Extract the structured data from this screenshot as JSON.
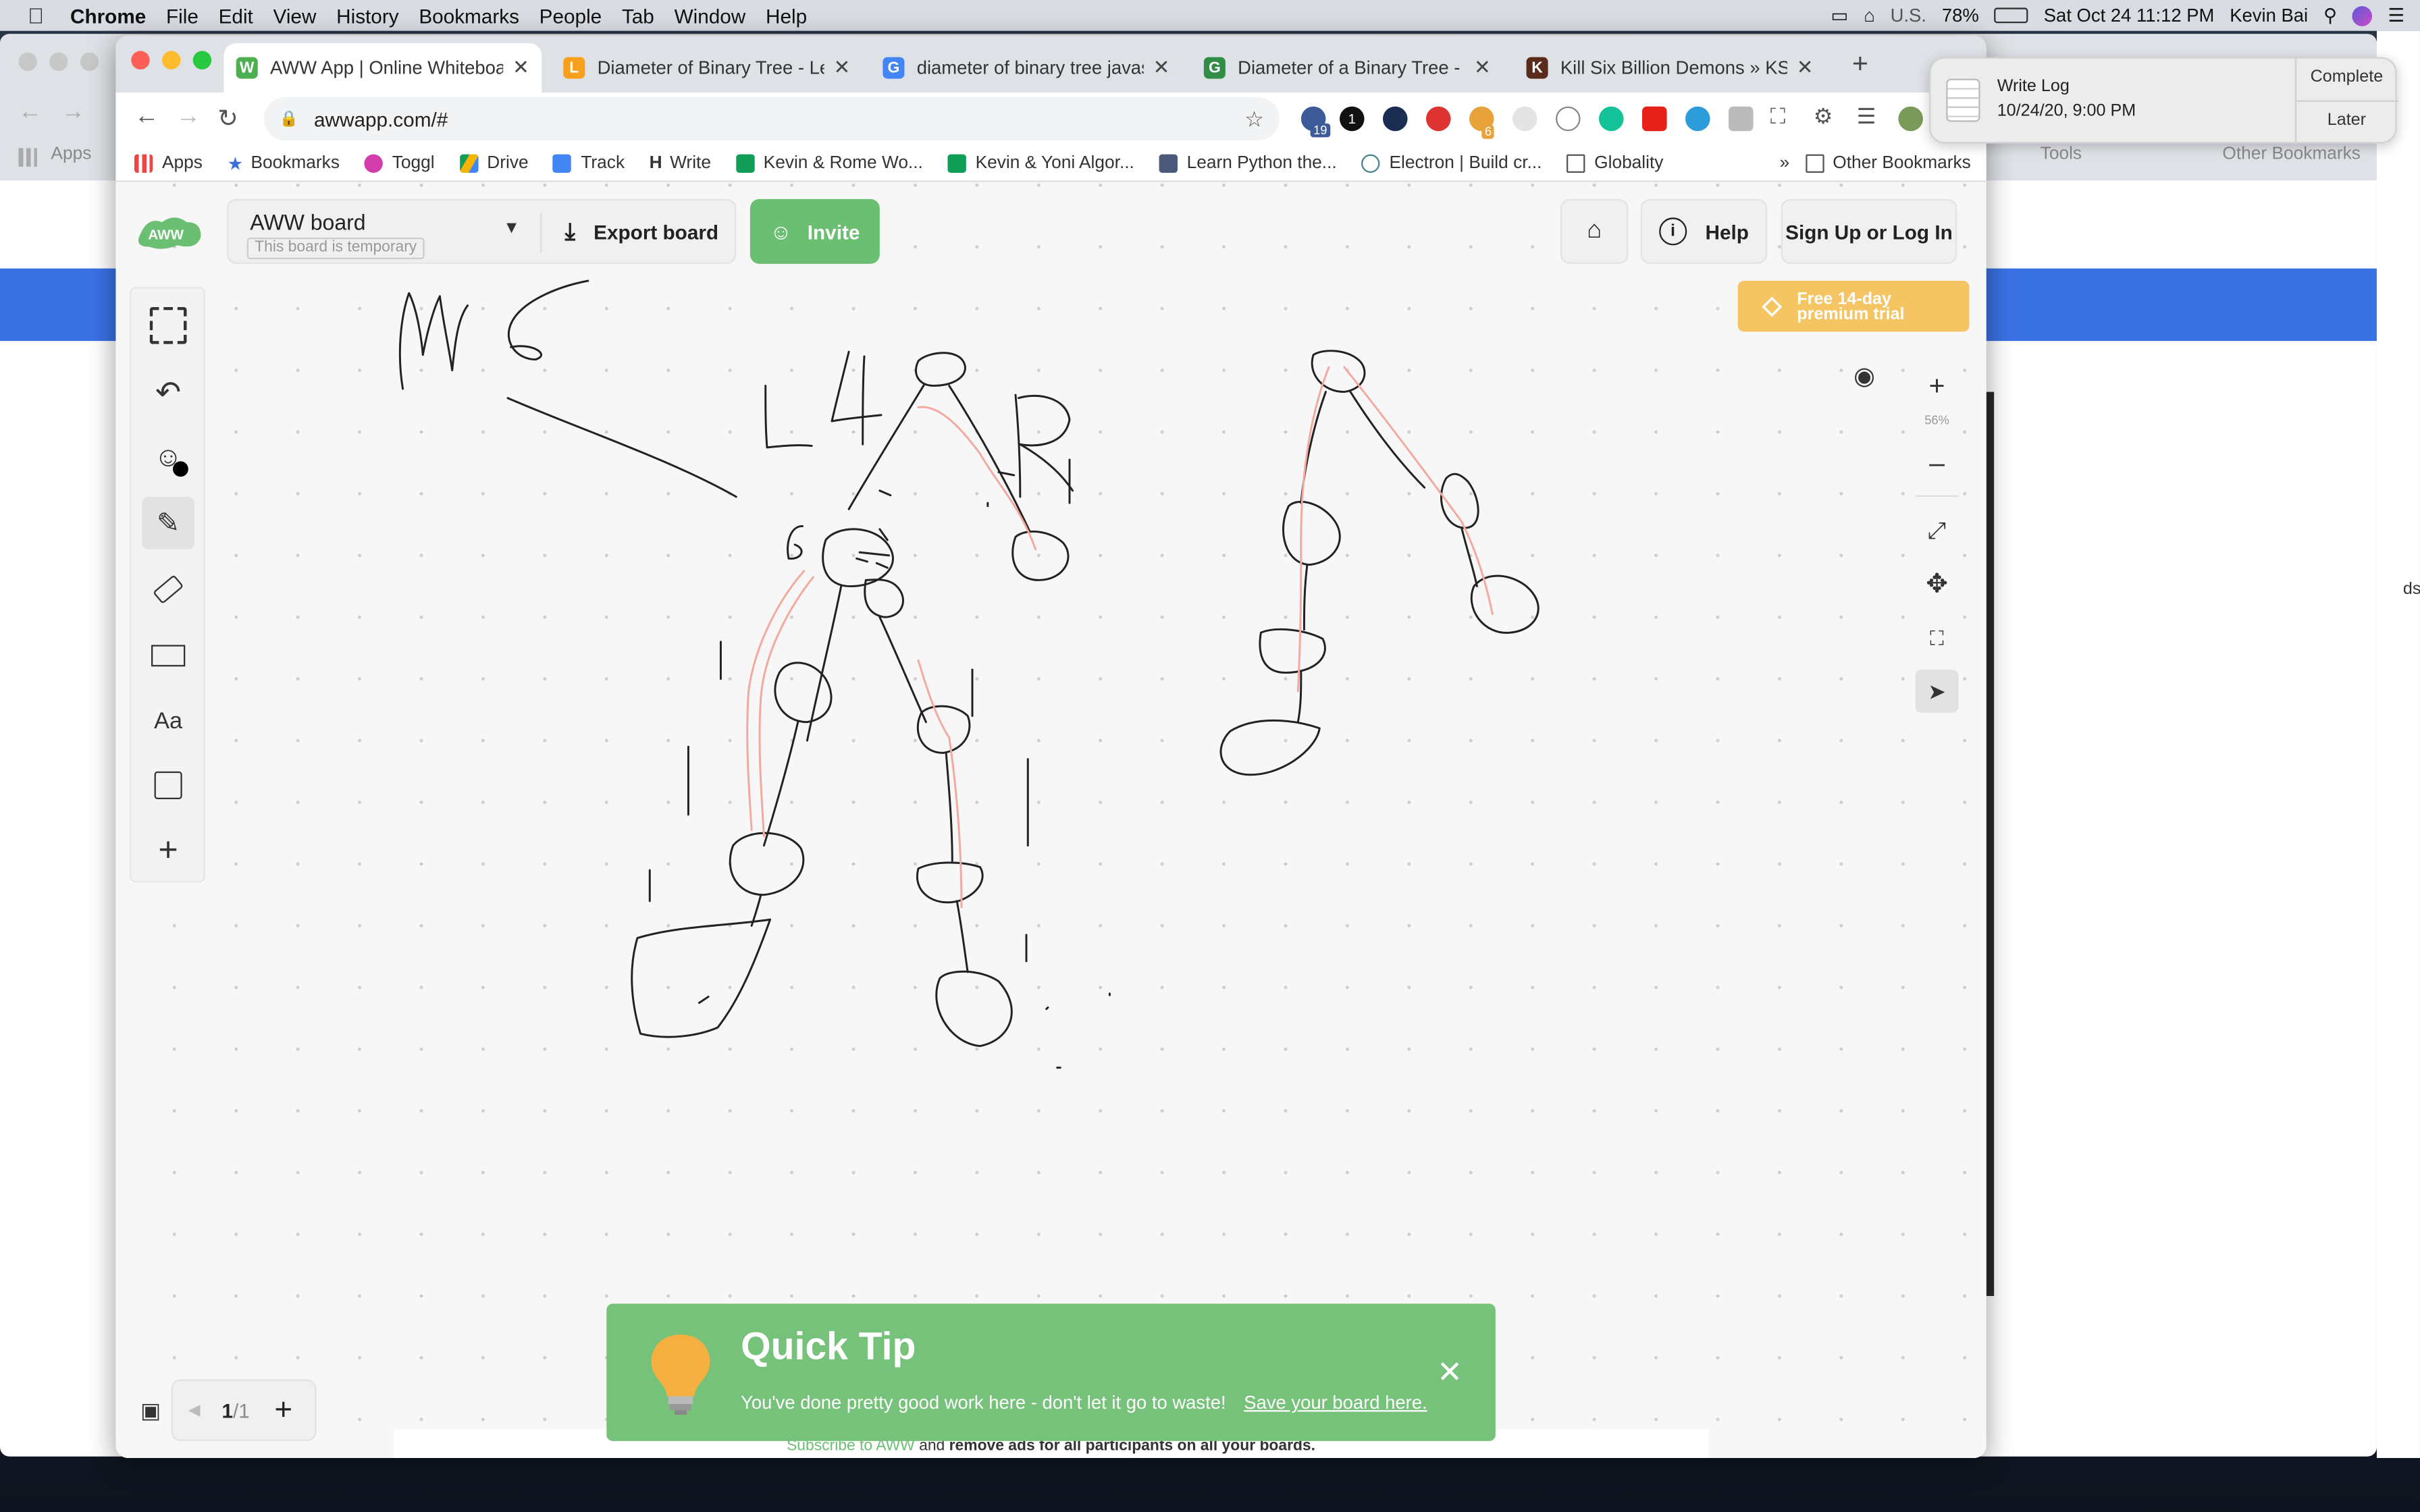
{
  "menubar": {
    "app": "Chrome",
    "items": [
      "File",
      "Edit",
      "View",
      "History",
      "Bookmarks",
      "People",
      "Tab",
      "Window",
      "Help"
    ],
    "input_source": "U.S.",
    "battery": "78%",
    "datetime": "Sat Oct 24  11:12 PM",
    "user": "Kevin Bai"
  },
  "tabs": [
    {
      "title": "AWW App | Online Whiteboard",
      "favicon_color": "#4caf50",
      "favicon_letter": "W"
    },
    {
      "title": "Diameter of Binary Tree - LeetC",
      "favicon_color": "#f89f1b",
      "favicon_letter": "L"
    },
    {
      "title": "diameter of binary tree javascri",
      "favicon_color": "#4285f4",
      "favicon_letter": "G"
    },
    {
      "title": "Diameter of a Binary Tree - Gee",
      "favicon_color": "#2f8d46",
      "favicon_letter": "G"
    },
    {
      "title": "Kill Six Billion Demons » KSBD",
      "favicon_color": "#5a2a1a",
      "favicon_letter": "K"
    }
  ],
  "omnibox": {
    "url": "awwapp.com/#"
  },
  "extensions": {
    "badge1": "19",
    "badge2": "1",
    "badge3": "6"
  },
  "bookmarks": {
    "items": [
      "Apps",
      "Bookmarks",
      "Toggl",
      "Drive",
      "Track",
      "Write",
      "Kevin & Rome Wo...",
      "Kevin & Yoni Algor...",
      "Learn Python the...",
      "Electron | Build cr...",
      "Globality"
    ],
    "overflow": "»",
    "other": "Other Bookmarks",
    "back_apps": "Apps",
    "back_tools": "Tools",
    "back_other": "Other Bookmarks"
  },
  "app": {
    "board_name": "AWW board",
    "board_status": "This board is temporary",
    "export_label": "Export board",
    "invite_label": "Invite",
    "help_label": "Help",
    "signup_label": "Sign Up or Log In",
    "premium_label_1": "Free 14-day",
    "premium_label_2": "premium trial",
    "zoom": "56%",
    "page_current": "1",
    "page_total": "/1",
    "text_tool_label": "Aa"
  },
  "tip": {
    "title": "Quick Tip",
    "text": "You've done pretty good work here - don't let it go to waste!",
    "link": "Save your board here.",
    "ad_prefix": "Subscribe to AWW",
    "ad_middle": " and ",
    "ad_bold": "remove ads for all participants on all your boards."
  },
  "notification": {
    "title": "Write Log",
    "time": "10/24/20, 9:00 PM",
    "complete": "Complete",
    "later": "Later"
  },
  "backwindow": {
    "edge_text": "ds"
  },
  "colors": {
    "accent_green": "#6bbf72",
    "tip_green": "#76c27b",
    "premium": "#f5c563",
    "ink": "#222222",
    "highlight": "#f3a9a0"
  }
}
